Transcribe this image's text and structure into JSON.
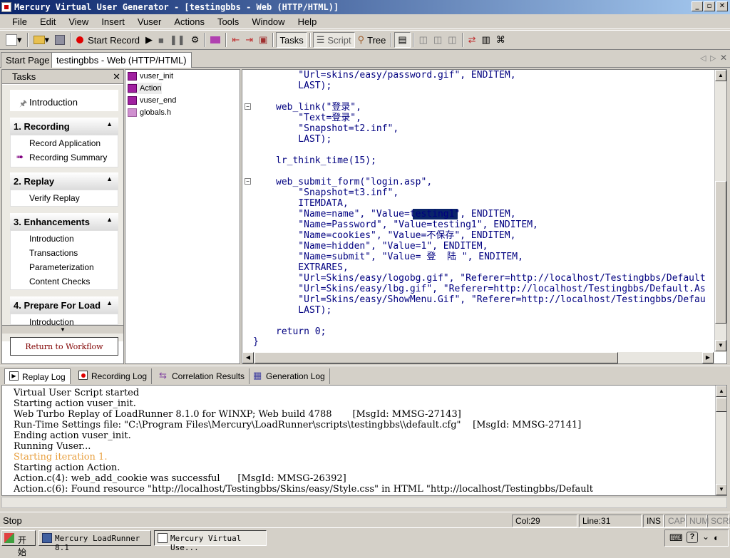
{
  "window": {
    "title": "Mercury Virtual User Generator - [testingbbs - Web (HTTP/HTML)]"
  },
  "menu": [
    "File",
    "Edit",
    "View",
    "Insert",
    "Vuser",
    "Actions",
    "Tools",
    "Window",
    "Help"
  ],
  "toolbar": {
    "start_record": "Start Record",
    "tasks": "Tasks",
    "script": "Script",
    "tree": "Tree"
  },
  "doc_tabs": [
    "Start Page",
    "testingbbs - Web (HTTP/HTML)"
  ],
  "tasks_panel": {
    "title": "Tasks",
    "intro": "Introduction",
    "sections": [
      {
        "title": "1. Recording",
        "items": [
          "Record Application",
          "Recording Summary"
        ]
      },
      {
        "title": "2. Replay",
        "items": [
          "Verify Replay"
        ]
      },
      {
        "title": "3. Enhancements",
        "items": [
          "Introduction",
          "Transactions",
          "Parameterization",
          "Content Checks"
        ]
      },
      {
        "title": "4. Prepare For Load",
        "items": [
          "Introduction"
        ]
      }
    ],
    "return_button": "Return to Workflow"
  },
  "tree": [
    "vuser_init",
    "Action",
    "vuser_end",
    "globals.h"
  ],
  "code": [
    "    \"Url=skins/easy/password.gif\", ENDITEM,",
    "    LAST);",
    "",
    "web_link(\"登录\",",
    "    \"Text=登录\",",
    "    \"Snapshot=t2.inf\",",
    "    LAST);",
    "",
    "lr_think_time(15);",
    "",
    "web_submit_form(\"login.asp\",",
    "    \"Snapshot=t3.inf\",",
    "    ITEMDATA,",
    "    \"Name=name\", \"Value=testing1\", ENDITEM,",
    "    \"Name=Password\", \"Value=testing1\", ENDITEM,",
    "    \"Name=cookies\", \"Value=不保存\", ENDITEM,",
    "    \"Name=hidden\", \"Value=1\", ENDITEM,",
    "    \"Name=submit\", \"Value= 登  陆 \", ENDITEM,",
    "    EXTRARES,",
    "    \"Url=Skins/easy/logobg.gif\", \"Referer=http://localhost/Testingbbs/Default",
    "    \"Url=Skins/easy/lbg.gif\", \"Referer=http://localhost/Testingbbs/Default.As",
    "    \"Url=Skins/easy/ShowMenu.Gif\", \"Referer=http://localhost/Testingbbs/Defau",
    "    LAST);",
    "",
    "return 0;",
    "}"
  ],
  "bottom_tabs": [
    "Replay Log",
    "Recording Log",
    "Correlation Results",
    "Generation Log"
  ],
  "log": [
    "Virtual User Script started",
    "Starting action vuser_init.",
    "Web Turbo Replay of LoadRunner 8.1.0 for WINXP; Web build 4788       [MsgId: MMSG-27143]",
    "Run-Time Settings file: \"C:\\Program Files\\Mercury\\LoadRunner\\scripts\\testingbbs\\\\default.cfg\"    [MsgId: MMSG-27141]",
    "Ending action vuser_init.",
    "Running Vuser...",
    "Starting iteration 1.",
    "Starting action Action.",
    "Action.c(4): web_add_cookie was successful      [MsgId: MMSG-26392]",
    "Action.c(6): Found resource \"http://localhost/Testingbbs/Skins/easy/Style.css\" in HTML \"http://localhost/Testingbbs/Default"
  ],
  "status": {
    "left": "Stop",
    "col": "Col:29",
    "line": "Line:31",
    "ins": "INS",
    "cap": "CAP",
    "num": "NUM",
    "scrl": "SCRL"
  },
  "taskbar": {
    "start": "开始",
    "items": [
      "Mercury LoadRunner 8.1",
      "Mercury Virtual Use..."
    ]
  }
}
